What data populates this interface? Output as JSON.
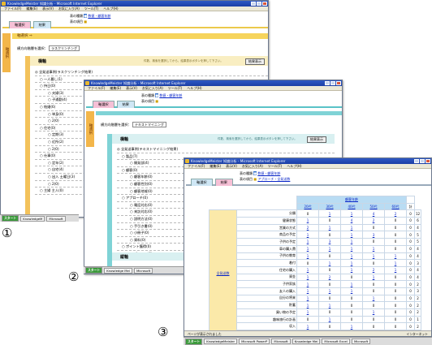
{
  "window1": {
    "title": "KnowledgeMeister 知識分析 - Microsoft Internet Explorer",
    "menu": [
      "ファイル(F)",
      "編集(E)",
      "表示(V)",
      "お気に入り(A)",
      "ツール(T)",
      "ヘルプ(H)"
    ],
    "info_label1": "表の種類",
    "info_value1": "数値・顧客年齢",
    "info_label2": "表の項目",
    "tabs": [
      "軸選択",
      "結果"
    ],
    "vertical_label": "軸選択",
    "section_title": "軸選択 ⇒",
    "select_label": "横方向階層を選択：",
    "select_value": "ラスクリンチング",
    "axis_title": "横軸",
    "axis_hint": "件数、検索を選択してから、結果表示ボタンを押して下さい。",
    "axis_button": "結果表示",
    "tree": [
      "◎ 全発送事例(ラスクリンチング結果)",
      "○ 一人暮し(1)",
      "○ 持日(0)",
      "○ 夫婦(3)",
      "○ 子通勤(4)",
      "○ 結婚(6)",
      "○ 単身(0)",
      "○ 2(0)",
      "○ 住宅(0)",
      "○ 定期(3)",
      "○ 近所(2)",
      "○ 2(0)",
      "○ 仕事(0)",
      "○ 定年(2)",
      "○ 自宅(4)",
      "○ 出入 土曜日(3)",
      "○ 2(0)",
      "○ 主婦 主人(0)"
    ]
  },
  "window2": {
    "title": "KnowledgeMeister 知識分析 - Microsoft Internet Explorer",
    "menu": [
      "ファイル(F)",
      "編集(E)",
      "表示(V)",
      "お気に入り(A)",
      "ツール(T)",
      "ヘルプ(H)"
    ],
    "info_label1": "表の種類",
    "info_value1": "数値・顧客年齢",
    "info_label2": "表の項目",
    "tabs": [
      "軸選択",
      "結果"
    ],
    "vertical_label": "軸選択",
    "select_label": "横方向階層を選択：",
    "select_value": "テキストマイニング",
    "axis_title": "横軸",
    "axis_hint": "件数、検索を選択してから、結果表示ボタンを押して下さい。",
    "axis_button": "結果表示",
    "tree": [
      "◎ 全発送事例(テキストマイニング結果)",
      "○ 製品(7)",
      "○ 開発部(4)",
      "○ 顧客(0)",
      "○ 顧客年齢(0)",
      "○ 顧客性別(0)",
      "○ 顧客地域(0)",
      "○ アプローチ(0)",
      "○ 電話対応(0)",
      "○ 来訪対応(0)",
      "○ 説明方法(0)",
      "○ 手引き書(0)",
      "○ 小冊子(0)",
      "○ 資料(0)",
      "○ ポイント獲得(0)",
      "○ ポイント(0)"
    ],
    "axis2_title": "縦軸"
  },
  "window3": {
    "title": "KnowledgeMeister 知識分析 - Microsoft Internet Explorer",
    "menu": [
      "ファイル(F)",
      "編集(E)",
      "表示(V)",
      "お気に入り(A)",
      "ツール(T)",
      "ヘルプ(H)"
    ],
    "info_label1": "表の種類",
    "info_value1": "数値・顧客年齢",
    "info_label2": "表の項目",
    "info_value2": "アプローチ・全発送数",
    "tabs": [
      "軸選択",
      "結果"
    ],
    "col_group": "顧客年齢",
    "col_headers": [
      "20代",
      "30代",
      "40代",
      "50代",
      "60代",
      "計"
    ],
    "row_group": "全発送数",
    "rows": [
      {
        "label": "分類",
        "values": [
          "0",
          "1",
          "1",
          "4",
          "2",
          "0",
          "12"
        ]
      },
      {
        "label": "健康状態",
        "values": [
          "1",
          "0",
          "4",
          "2",
          "0",
          "0",
          "6"
        ]
      },
      {
        "label": "営業の方式",
        "values": [
          "2",
          "1",
          "1",
          "0",
          "0",
          "0",
          "4"
        ]
      },
      {
        "label": "商品の予定",
        "values": [
          "1",
          "0",
          "1",
          "3",
          "0",
          "0",
          "5"
        ]
      },
      {
        "label": "子供の予定",
        "values": [
          "1",
          "3",
          "1",
          "0",
          "0",
          "0",
          "5"
        ]
      },
      {
        "label": "車の購入費",
        "values": [
          "1",
          "1",
          "1",
          "1",
          "0",
          "0",
          "4"
        ]
      },
      {
        "label": "子供の教育",
        "values": [
          "1",
          "0",
          "1",
          "1",
          "1",
          "0",
          "4"
        ]
      },
      {
        "label": "着付",
        "values": [
          "0",
          "1",
          "1",
          "0",
          "1",
          "0",
          "3"
        ]
      },
      {
        "label": "住宅の購入",
        "values": [
          "1",
          "0",
          "1",
          "2",
          "1",
          "0",
          "4"
        ]
      },
      {
        "label": "資金",
        "values": [
          "1",
          "2",
          "0",
          "1",
          "0",
          "0",
          "4"
        ]
      },
      {
        "label": "子供家族",
        "values": [
          "1",
          "0",
          "1",
          "0",
          "0",
          "0",
          "2"
        ]
      },
      {
        "label": "友人の購入",
        "values": [
          "1",
          "1",
          "1",
          "0",
          "0",
          "0",
          "3"
        ]
      },
      {
        "label": "自分の将来",
        "values": [
          "1",
          "0",
          "0",
          "1",
          "0",
          "0",
          "2"
        ]
      },
      {
        "label": "貯蓄",
        "values": [
          "1",
          "1",
          "0",
          "0",
          "0",
          "0",
          "2"
        ]
      },
      {
        "label": "買い物の予定",
        "values": [
          "1",
          "0",
          "0",
          "1",
          "0",
          "0",
          "2"
        ]
      },
      {
        "label": "趣味旅行の計画",
        "values": [
          "0",
          "1",
          "0",
          "0",
          "0",
          "0",
          "1"
        ]
      },
      {
        "label": "収入",
        "values": [
          "1",
          "0",
          "1",
          "0",
          "0",
          "0",
          "2"
        ]
      },
      {
        "label": "自分の家族の予定",
        "values": [
          "0",
          "1",
          "0",
          "0",
          "0",
          "0",
          "1"
        ]
      }
    ],
    "status": "ページが表示されました",
    "status_right": "インターネット"
  },
  "taskbar1": [
    "スタート",
    "KnowledgeM",
    "Microsoft"
  ],
  "taskbar2": [
    "スタート",
    "Knowledge Mei",
    "Microsoft"
  ],
  "taskbar3": [
    "スタート",
    "KnowledgeMeister",
    "Microsoft PowerP",
    "Microsoft",
    "Knowledge Mei",
    "Microsoft Excel",
    "Microsoft"
  ],
  "labels": [
    "①",
    "②",
    "③"
  ]
}
